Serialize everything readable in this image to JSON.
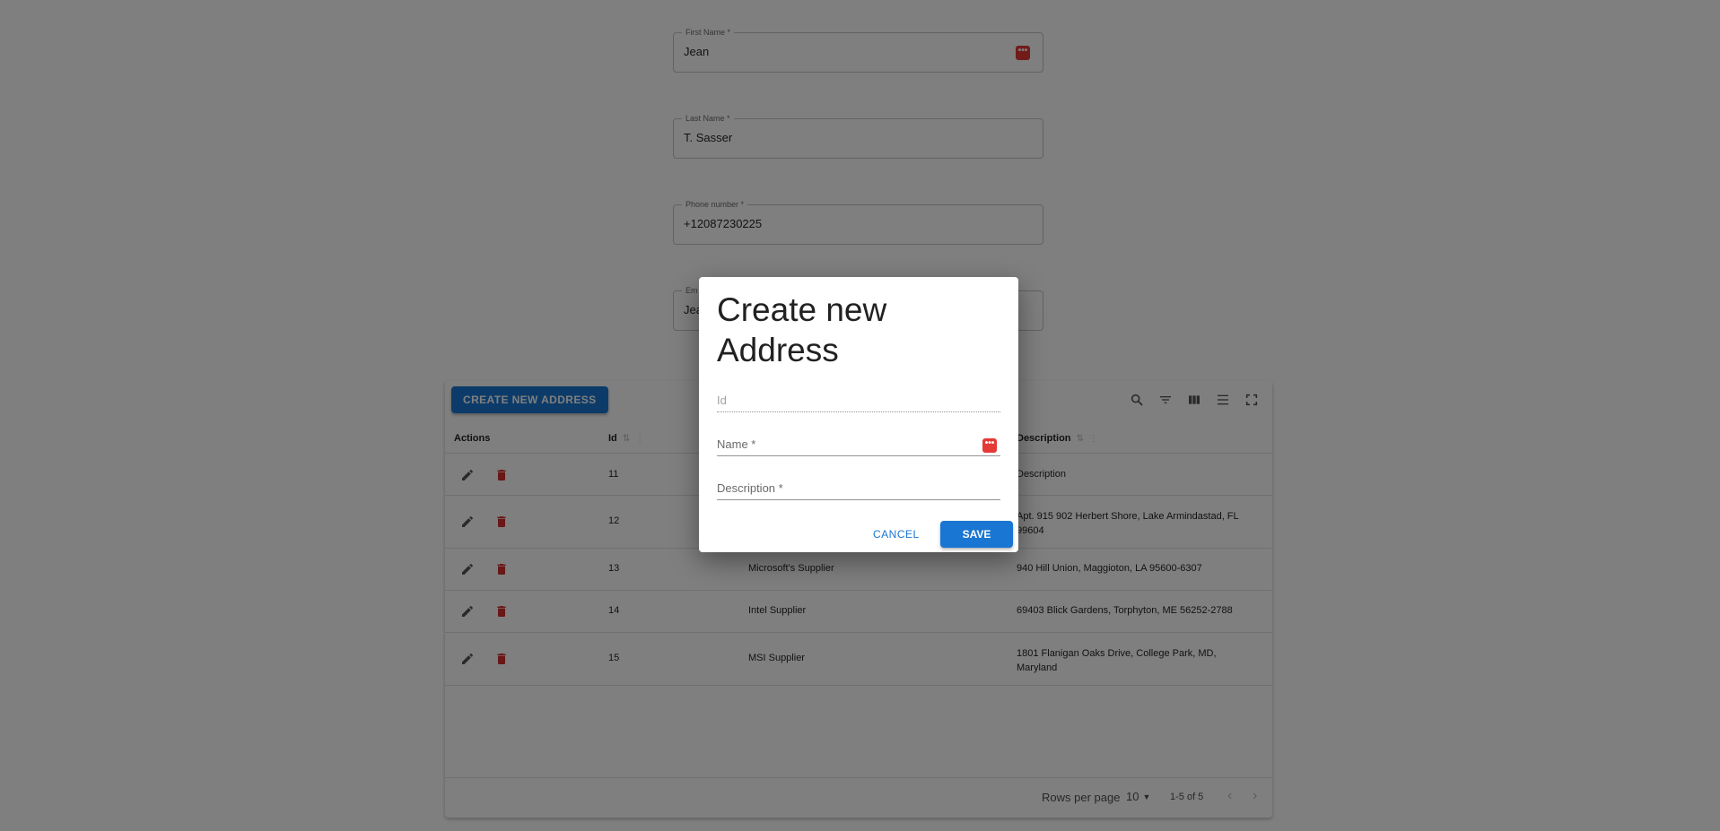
{
  "form": {
    "first_name": {
      "label": "First Name *",
      "value": "Jean"
    },
    "last_name": {
      "label": "Last Name *",
      "value": "T. Sasser"
    },
    "phone": {
      "label": "Phone number *",
      "value": "+12087230225"
    },
    "email": {
      "label": "Em",
      "value": "Jea"
    }
  },
  "table": {
    "create_button": "CREATE NEW ADDRESS",
    "columns": [
      "Actions",
      "Id",
      "Description"
    ],
    "rows": [
      {
        "id": "11",
        "name": "",
        "description": "Description"
      },
      {
        "id": "12",
        "name": "",
        "description": "Apt. 915 902 Herbert Shore, Lake Armindastad, FL 99604"
      },
      {
        "id": "13",
        "name": "Microsoft's Supplier",
        "description": "940 Hill Union, Maggioton, LA 95600-6307"
      },
      {
        "id": "14",
        "name": "Intel Supplier",
        "description": "69403 Blick Gardens, Torphyton, ME 56252-2788"
      },
      {
        "id": "15",
        "name": "MSI Supplier",
        "description": "1801 Flanigan Oaks Drive, College Park, MD, Maryland"
      }
    ],
    "footer": {
      "rows_per_page_label": "Rows per page",
      "rows_per_page_value": "10",
      "range": "1-5 of 5"
    }
  },
  "dialog": {
    "title": "Create new Address",
    "fields": {
      "id": "Id",
      "name": "Name *",
      "description": "Description *"
    },
    "cancel": "CANCEL",
    "save": "SAVE"
  },
  "colors": {
    "primary": "#1976d2",
    "danger": "#d32f2f"
  }
}
